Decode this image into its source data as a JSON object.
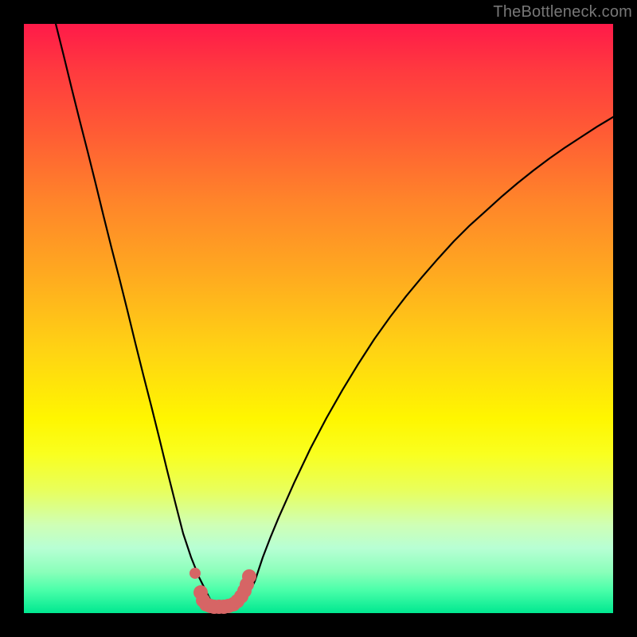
{
  "watermark": {
    "text": "TheBottleneck.com"
  },
  "colors": {
    "curve": "#000000",
    "marker": "#d66565",
    "frame": "#000000"
  },
  "chart_data": {
    "type": "line",
    "title": "",
    "xlabel": "",
    "ylabel": "",
    "xlim": [
      0,
      100
    ],
    "ylim": [
      0,
      100
    ],
    "grid": false,
    "series": [
      {
        "name": "bottleneck-curve",
        "x": [
          5.41,
          6.76,
          8.11,
          9.46,
          10.81,
          12.16,
          13.51,
          14.86,
          16.22,
          17.57,
          18.92,
          20.27,
          21.62,
          22.97,
          24.32,
          25.68,
          27.03,
          28.38,
          29.73,
          31.08,
          31.76,
          32.43,
          33.78,
          35.14,
          36.49,
          37.84,
          39.19,
          40.54,
          41.89,
          43.24,
          45.95,
          48.65,
          51.35,
          54.05,
          56.76,
          59.46,
          62.16,
          64.86,
          67.57,
          70.27,
          72.97,
          75.68,
          78.38,
          81.08,
          83.78,
          86.49,
          89.19,
          91.89,
          94.59,
          97.3,
          100.0
        ],
        "y": [
          100.0,
          94.59,
          89.05,
          83.65,
          78.38,
          72.97,
          67.43,
          62.03,
          56.76,
          51.35,
          45.81,
          40.41,
          35.14,
          29.73,
          24.19,
          18.78,
          13.51,
          9.46,
          6.08,
          3.38,
          2.03,
          1.35,
          1.35,
          1.35,
          1.35,
          2.7,
          5.41,
          9.46,
          12.97,
          16.22,
          22.3,
          27.97,
          33.11,
          37.84,
          42.3,
          46.49,
          50.27,
          53.78,
          57.03,
          60.14,
          63.11,
          65.81,
          68.24,
          70.68,
          72.97,
          75.14,
          77.16,
          79.05,
          80.81,
          82.57,
          84.19
        ]
      },
      {
        "name": "sweet-spot-markers",
        "x": [
          29.05,
          30.0,
          30.41,
          30.95,
          31.62,
          32.3,
          33.11,
          33.92,
          34.73,
          35.54,
          36.22,
          36.89,
          37.43,
          37.84,
          38.24
        ],
        "y": [
          6.76,
          3.51,
          2.16,
          1.49,
          1.22,
          1.08,
          1.08,
          1.08,
          1.22,
          1.49,
          2.03,
          2.84,
          3.78,
          4.86,
          6.22
        ]
      }
    ],
    "annotations": [
      {
        "text": "TheBottleneck.com",
        "x": 100,
        "y": 102,
        "ha": "right"
      }
    ],
    "background_gradient": {
      "direction": "vertical",
      "stops": [
        {
          "pos": 0.0,
          "color": "#ff1a49"
        },
        {
          "pos": 0.3,
          "color": "#ff842a"
        },
        {
          "pos": 0.55,
          "color": "#ffd214"
        },
        {
          "pos": 0.73,
          "color": "#f9ff1f"
        },
        {
          "pos": 0.93,
          "color": "#8affba"
        },
        {
          "pos": 1.0,
          "color": "#00e890"
        }
      ]
    }
  }
}
